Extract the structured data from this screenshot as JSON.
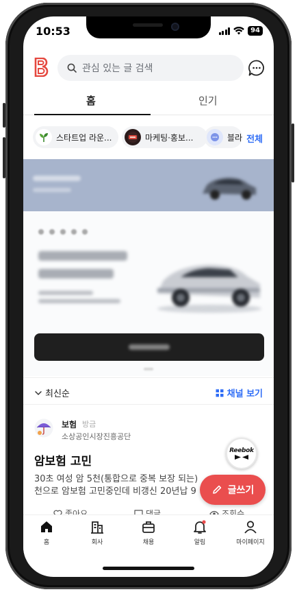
{
  "status_bar": {
    "time": "10:53",
    "battery": "94"
  },
  "header": {
    "search_placeholder": "관심 있는 글 검색"
  },
  "tabs": [
    {
      "label": "홈",
      "active": true
    },
    {
      "label": "인기",
      "active": false
    }
  ],
  "channels": {
    "chips": [
      {
        "label": "스타트업 라운..."
      },
      {
        "label": "마케팅·홍보..."
      },
      {
        "label": "블라"
      }
    ],
    "see_all": "전체"
  },
  "sort_bar": {
    "sort_label": "최신순",
    "channel_view": "채널 보기"
  },
  "post": {
    "author": "보험",
    "author_badge": "방금",
    "organization": "소상공인시장진흥공단",
    "title": "암보험 고민",
    "body_lines": [
      "30초 여성 암 5천(통합으로 중복 보장 되는)",
      "천으로 암보험 고민중인데 비갱신 20년납 9"
    ],
    "actions": {
      "like": "좋아요",
      "comment": "댓글",
      "views": "조회수"
    }
  },
  "floating": {
    "ad_brand": "Reebok",
    "write_button": "글쓰기"
  },
  "bottom_nav": [
    {
      "label": "홈",
      "icon": "home-icon"
    },
    {
      "label": "회사",
      "icon": "company-icon"
    },
    {
      "label": "채용",
      "icon": "briefcase-icon"
    },
    {
      "label": "알림",
      "icon": "bell-icon"
    },
    {
      "label": "마이페이지",
      "icon": "person-icon"
    }
  ],
  "colors": {
    "brand": "#e5483f",
    "link": "#2f6df6",
    "fab": "#ea4e4e",
    "ad_banner": "#a7b4cc"
  }
}
